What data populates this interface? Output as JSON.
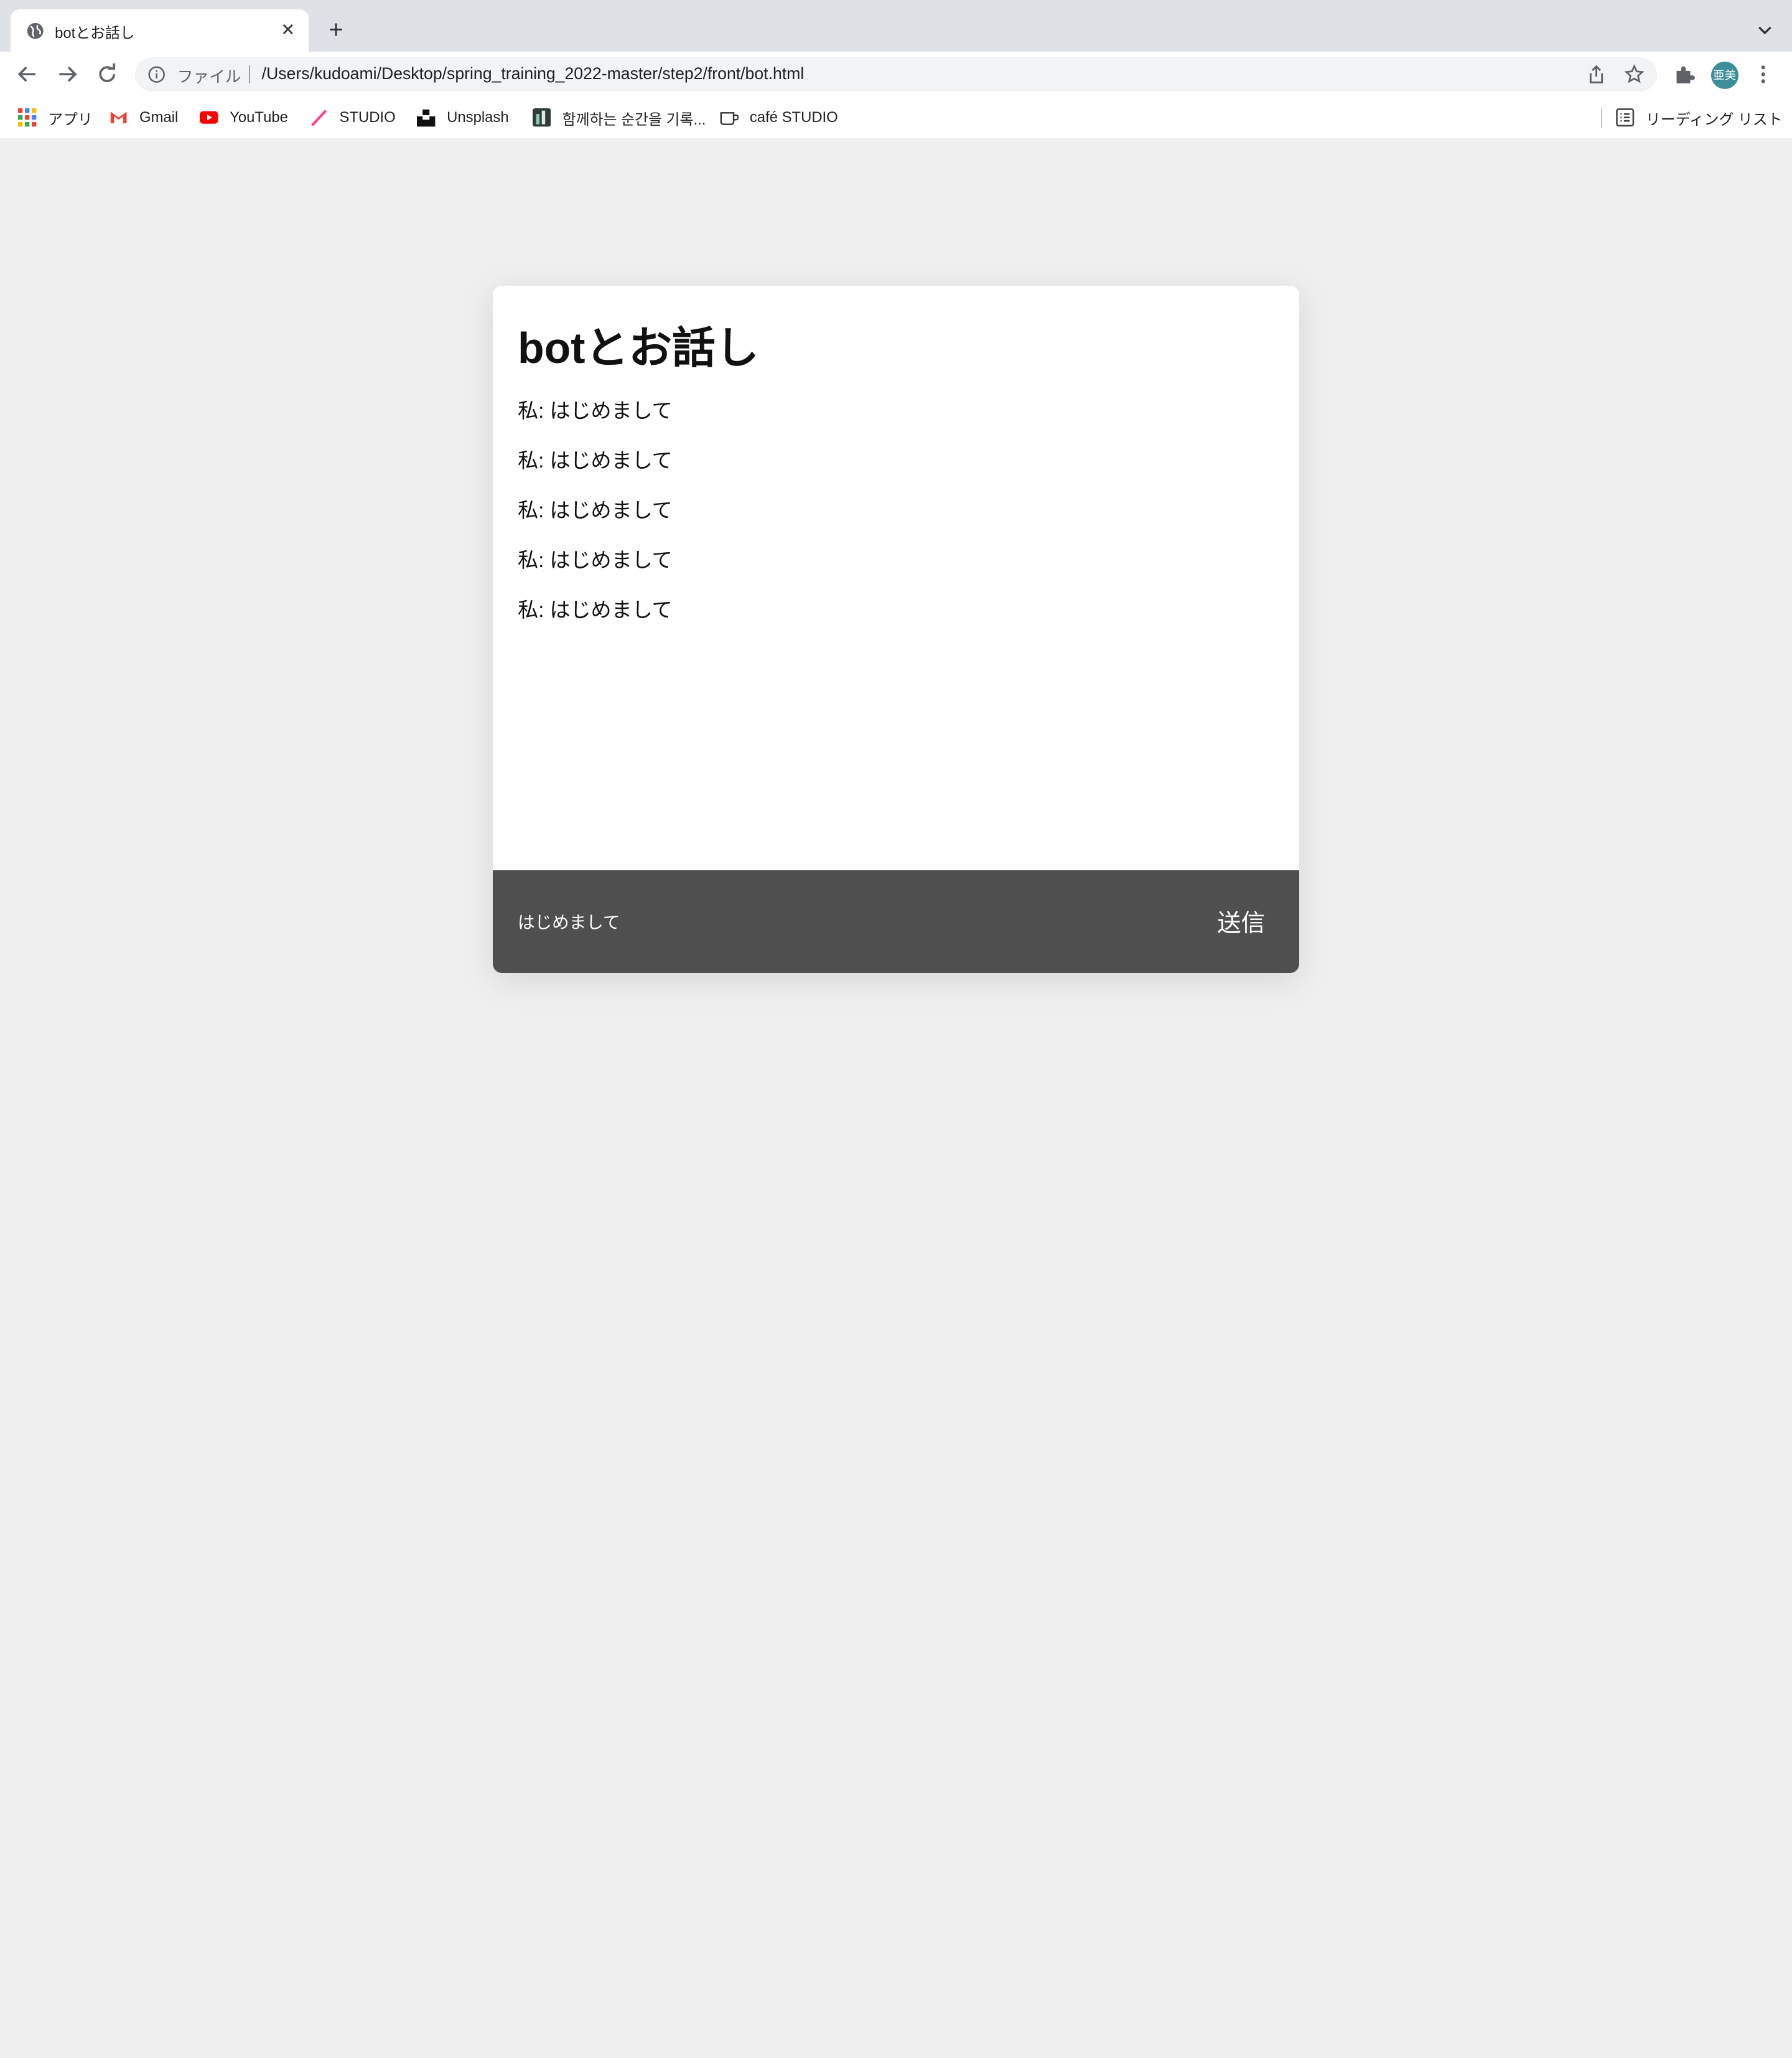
{
  "browser": {
    "tab_title": "botとお話し",
    "new_tab_symbol": "+",
    "close_symbol": "✕",
    "scheme_label": "ファイル",
    "url": "/Users/kudoami/Desktop/spring_training_2022-master/step2/front/bot.html",
    "avatar_text": "亜美",
    "bookmarks": [
      {
        "label": "アプリ",
        "icon": "apps-grid-icon"
      },
      {
        "label": "Gmail",
        "icon": "gmail-icon"
      },
      {
        "label": "YouTube",
        "icon": "youtube-icon"
      },
      {
        "label": "STUDIO",
        "icon": "studio-icon"
      },
      {
        "label": "Unsplash",
        "icon": "unsplash-icon"
      },
      {
        "label": "함께하는 순간을 기록...",
        "icon": "bookmark-site-icon"
      },
      {
        "label": "café STUDIO",
        "icon": "cafe-icon"
      }
    ],
    "reading_list": "リーディング リスト"
  },
  "app": {
    "title": "botとお話し",
    "messages": [
      "私: はじめまして",
      "私: はじめまして",
      "私: はじめまして",
      "私: はじめまして",
      "私: はじめまして"
    ],
    "input_value": "はじめまして",
    "send_label": "送信"
  },
  "colors": {
    "page_background": "#efefef",
    "composer_background": "#4f4f4f",
    "card_background": "#ffffff"
  }
}
